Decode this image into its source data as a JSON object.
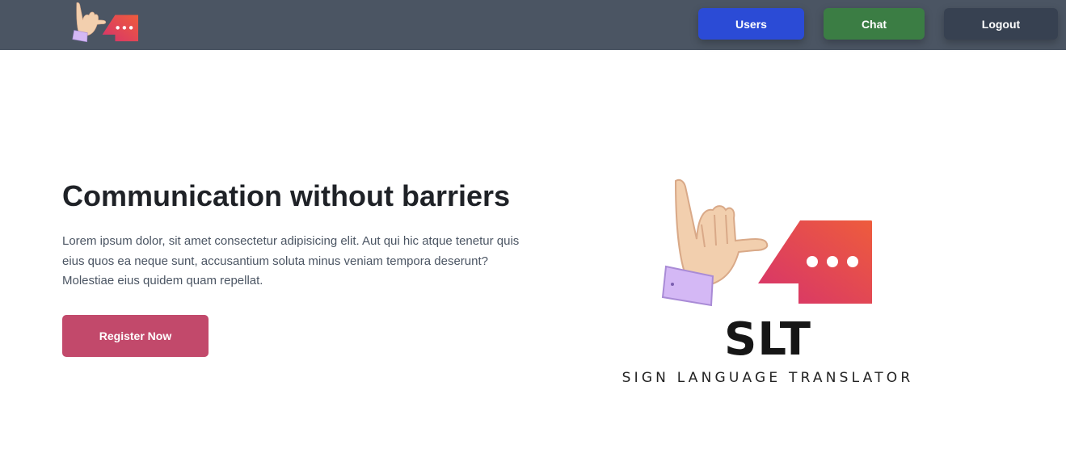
{
  "nav": {
    "users_label": "Users",
    "chat_label": "Chat",
    "logout_label": "Logout"
  },
  "hero": {
    "title": "Communication without barriers",
    "description": "Lorem ipsum dolor, sit amet consectetur adipisicing elit. Aut qui hic atque tenetur quis eius quos ea neque sunt, accusantium soluta minus veniam tempora deserunt? Molestiae eius quidem quam repellat.",
    "cta_label": "Register Now"
  },
  "brand": {
    "name": "SLT",
    "tagline": "SIGN LANGUAGE TRANSLATOR"
  },
  "colors": {
    "navbar": "#4b5563",
    "users_button": "#2b4bd6",
    "chat_button": "#3b7d44",
    "logout_button": "#374151",
    "cta_button": "#c2496b",
    "bubble_gradient_start": "#d6336c",
    "bubble_gradient_end": "#ee5c3c",
    "hand_skin": "#f2cfae",
    "sleeve": "#d4b8f5"
  },
  "icons": {
    "nav_logo": "slt-logo-icon",
    "hero_logo": "slt-logo-icon"
  }
}
